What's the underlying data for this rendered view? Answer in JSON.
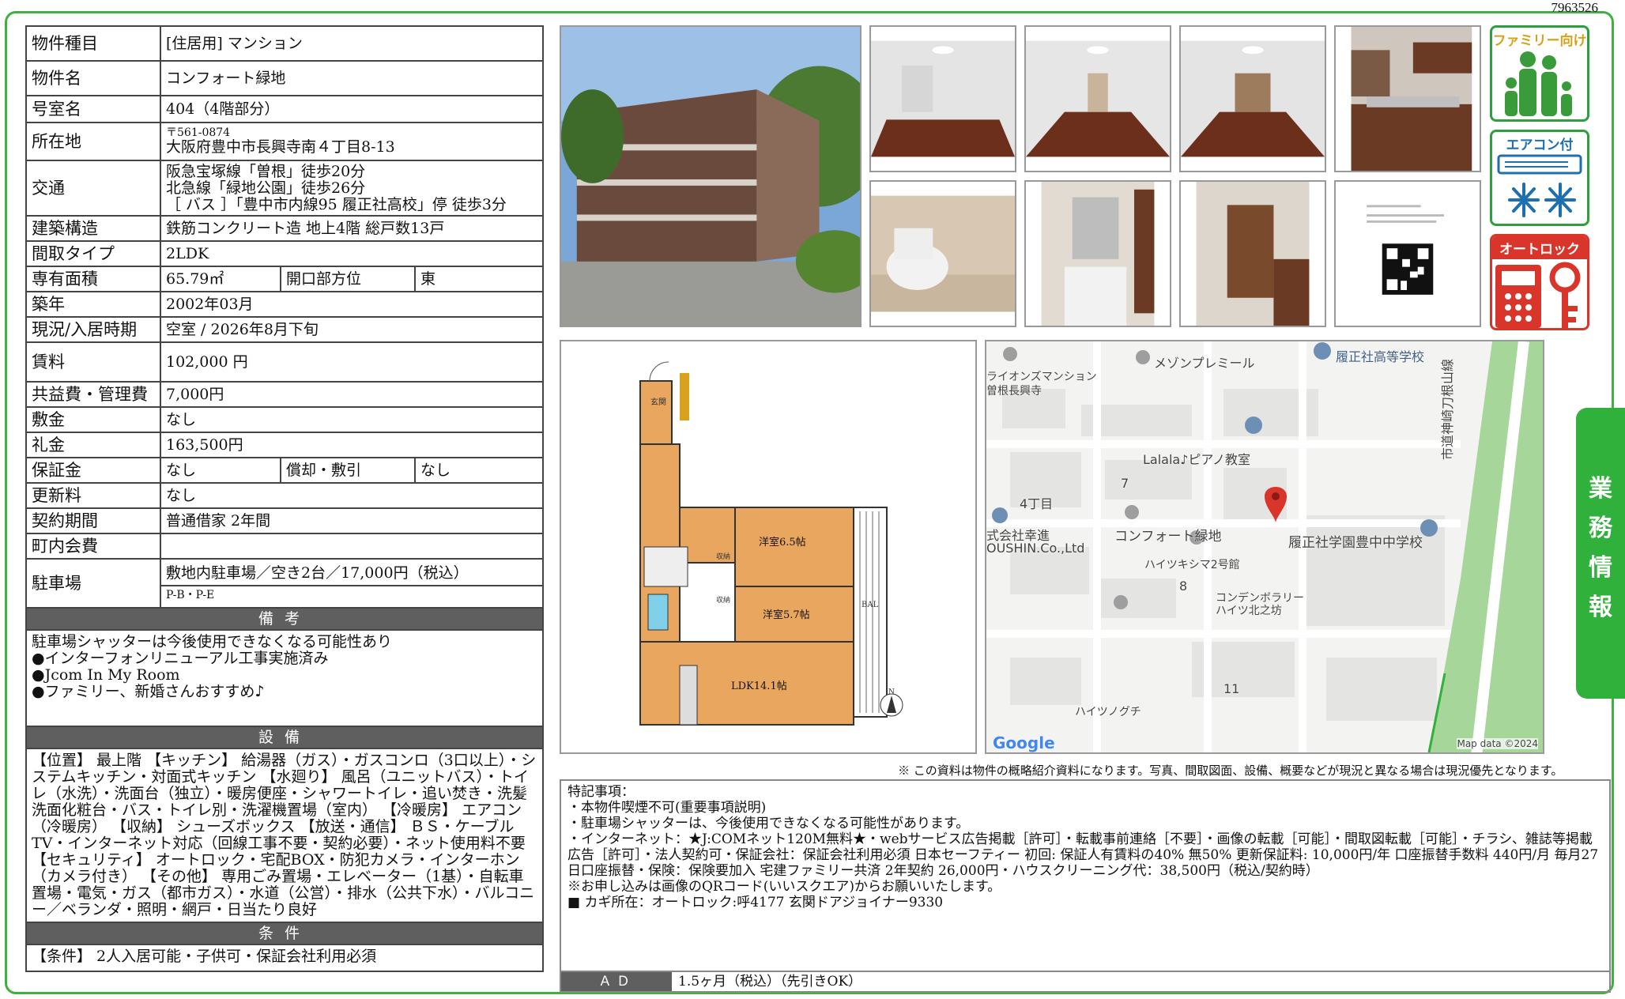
{
  "doc_id": "7963526",
  "spec": {
    "type_label": "物件種目",
    "type_value": "[住居用] マンション",
    "name_label": "物件名",
    "name_value": "コンフォート緑地",
    "room_label": "号室名",
    "room_value": "404（4階部分）",
    "address_label": "所在地",
    "postal": "〒561-0874",
    "address": "大阪府豊中市長興寺南４丁目8-13",
    "transport_label": "交通",
    "transport": [
      "阪急宝塚線「曽根」徒歩20分",
      "北急線「緑地公園」徒歩26分",
      "［ バス ］「豊中市内線95 履正社高校」停 徒歩3分"
    ],
    "structure_label": "建築構造",
    "structure_value": "鉄筋コンクリート造 地上4階 総戸数13戸",
    "layout_label": "間取タイプ",
    "layout_value": "2LDK",
    "area_label": "専有面積",
    "area_value": "65.79㎡",
    "opening_label": "開口部方位",
    "opening_value": "東",
    "built_label": "築年",
    "built_value": "2002年03月",
    "status_label": "現況/入居時期",
    "status_value": "空室 / 2026年8月下旬",
    "rent_label": "賃料",
    "rent_value": "102,000 円",
    "fee_label": "共益費・管理費",
    "fee_value": "7,000円",
    "deposit_label": "敷金",
    "deposit_value": "なし",
    "keymoney_label": "礼金",
    "keymoney_value": "163,500円",
    "guarantee_label": "保証金",
    "guarantee_value": "なし",
    "amort_label": "償却・敷引",
    "amort_value": "なし",
    "renewal_label": "更新料",
    "renewal_value": "なし",
    "contract_label": "契約期間",
    "contract_value": "普通借家 2年間",
    "town_label": "町内会費",
    "town_value": "",
    "parking_label": "駐車場",
    "parking_value": "敷地内駐車場／空き2台／17,000円（税込）",
    "parking_sub": "P-B・P-E"
  },
  "remarks": {
    "title": "備考",
    "lines": [
      "駐車場シャッターは今後使用できなくなる可能性あり",
      "●インターフォンリニューアル工事実施済み",
      "●Jcom In My Room",
      "●ファミリー、新婚さんおすすめ♪"
    ]
  },
  "equipment": {
    "title": "設備",
    "text": "【位置】 最上階 【キッチン】 給湯器（ガス）・ガスコンロ（3口以上）・システムキッチン・対面式キッチン 【水廻り】 風呂（ユニットバス）・トイレ（水洗）・洗面台（独立）・暖房便座・シャワートイレ・追い焚き・洗髪洗面化粧台・バス・トイレ別・洗濯機置場（室内） 【冷暖房】 エアコン（冷暖房） 【収納】 シューズボックス 【放送・通信】 ＢＳ・ケーブルTV・インターネット対応（回線工事不要・契約必要）・ネット使用料不要 【セキュリティ】 オートロック・宅配BOX・防犯カメラ・インターホン（カメラ付き） 【その他】 専用ごみ置場・エレベーター（1基）・自転車置場・電気・ガス（都市ガス）・水道（公営）・排水（公共下水）・バルコニー／ベランダ・照明・網戸・日当たり良好"
  },
  "conditions": {
    "title": "条件",
    "text": "【条件】 2人入居可能・子供可・保証会社利用必須"
  },
  "badges": {
    "family": "ファミリー向け",
    "aircon": "エアコン付",
    "autolock": "オートロック"
  },
  "floorplan": {
    "rooms": [
      "洋室6.5帖",
      "洋室5.7帖",
      "LDK14.1帖"
    ],
    "entrance": "玄関",
    "storage1": "収納",
    "storage2": "収納",
    "balcony": "BAL",
    "north": "N"
  },
  "map": {
    "labels": [
      "履正社高等学校",
      "メゾンプレミール",
      "ライオンズマンション",
      "曽根長興寺",
      "Lalala♪ピアノ教室",
      "4丁目",
      "7",
      "式会社幸進",
      "OUSHIN.Co.,Ltd",
      "コンフォート緑地",
      "履正社学園豊中中学校",
      "ハイツキシマ2号館",
      "8",
      "コンデンボラリー",
      "ハイツ北之坊",
      "ハイツノグチ",
      "11",
      "市道神崎刀根山線"
    ],
    "attribution": "Map data ©2024",
    "logo": "Google"
  },
  "note": "※ この資料は物件の概略紹介資料になります。写真、間取図面、設備、概要などが現況と異なる場合は現況優先となります。",
  "special": {
    "title": "特記事項：",
    "lines": [
      "・本物件喫煙不可(重要事項説明)",
      "・駐車場シャッターは、今後使用できなくなる可能性があります。",
      "・インターネット：★J:COMネット120M無料★・webサービス広告掲載［許可］・転載事前連絡［不要］・画像の転載［可能］・間取図転載［可能］・チラシ、雑誌等掲載広告［許可］・法人契約可・保証会社：保証会社利用必須 日本セーフティー 初回: 保証人有賃料の40% 無50% 更新保証料: 10,000円/年 口座振替手数料 440円/月 毎月27日口座振替・保険：保険要加入 宅建ファミリー共済 2年契約 26,000円・ハウスクリーニング代：38,500円（税込/契約時）",
      "※お申し込みは画像のQRコード(いいスクエア)からお願いいたします。",
      "■ カギ所在：オートロック:呼4177 玄関ドアジョイナー9330"
    ]
  },
  "ad": {
    "label": "ＡＤ",
    "value": "1.5ヶ月（税込）（先引きOK）"
  },
  "side_tab": [
    "業",
    "務",
    "情",
    "報"
  ],
  "colors": {
    "green": "#2fb13b",
    "header_gray": "#5f5f5f",
    "pin_red": "#d9352b"
  }
}
